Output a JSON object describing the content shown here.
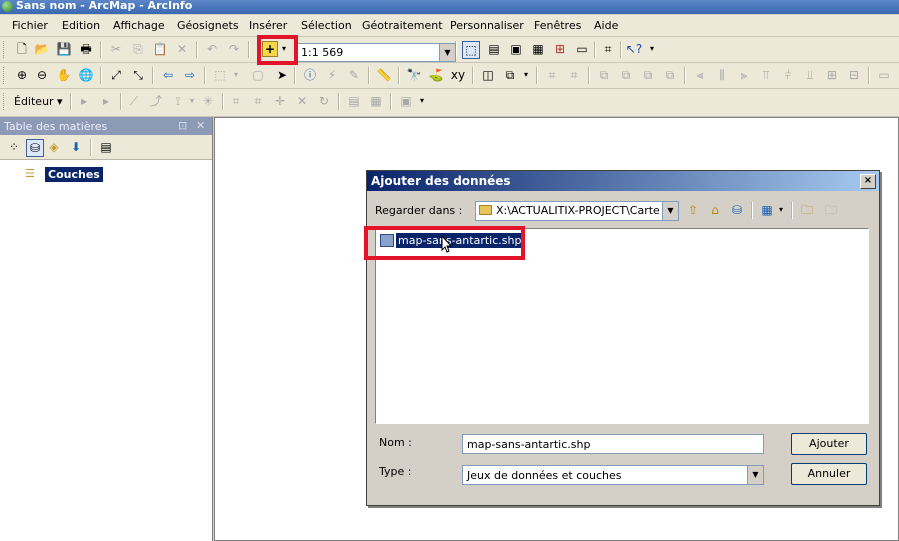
{
  "window": {
    "title": "Sans nom - ArcMap - ArcInfo"
  },
  "menu": [
    "Fichier",
    "Edition",
    "Affichage",
    "Géosignets",
    "Insérer",
    "Sélection",
    "Géotraitement",
    "Personnaliser",
    "Fenêtres",
    "Aide"
  ],
  "toolbar": {
    "scale": "1:1 569"
  },
  "editor_toolbar": {
    "editor_label": "Éditeur ▾"
  },
  "toc": {
    "title": "Table des matières",
    "layers_label": "Couches"
  },
  "dialog": {
    "title": "Ajouter des données",
    "look_in_label": "Regarder dans :",
    "look_in_path": "X:\\ACTUALITIX-PROJECT\\Carte",
    "files": [
      {
        "name": "map-sans-antartic.shp"
      }
    ],
    "name_label": "Nom :",
    "name_value": "map-sans-antartic.shp",
    "type_label": "Type :",
    "type_value": "Jeux de données et couches",
    "add_button": "Ajouter",
    "cancel_button": "Annuler",
    "close_glyph": "×"
  },
  "colors": {
    "highlight": "#e3142a",
    "selection": "#0a246a"
  }
}
